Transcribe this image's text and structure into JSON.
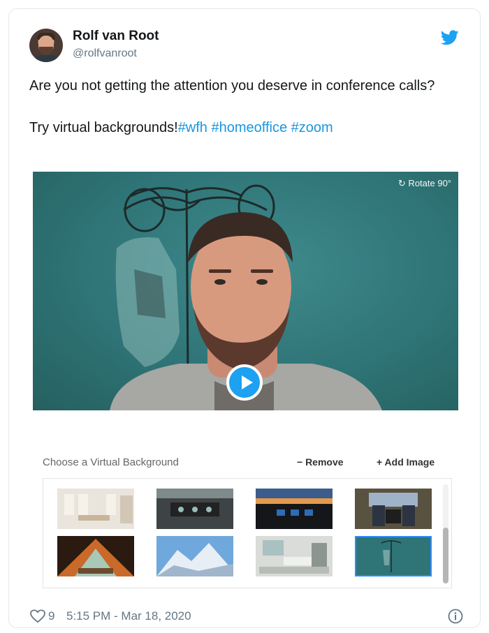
{
  "tweet": {
    "author_name": "Rolf van Root",
    "author_handle": "@rolfvanroot",
    "text_line1": "Are you not getting the attention you deserve in conference calls?",
    "text_line2_prefix": "Try virtual backgrounds!",
    "hashtags": [
      "#wfh",
      "#homeoffice",
      "#zoom"
    ],
    "like_count": "9",
    "timestamp": "5:15 PM - Mar 18, 2020"
  },
  "media": {
    "rotate_label": "↻ Rotate 90°",
    "play_icon": "play-icon"
  },
  "chooser": {
    "title": "Choose a Virtual Background",
    "remove_label": "− Remove",
    "add_label": "+ Add Image",
    "thumbnails": [
      {
        "label": "office-room"
      },
      {
        "label": "cockpit-dark"
      },
      {
        "label": "cockpit-sunset"
      },
      {
        "label": "cockpit-crew"
      },
      {
        "label": "tent-view"
      },
      {
        "label": "mountains"
      },
      {
        "label": "hospital-room"
      },
      {
        "label": "iv-drip",
        "selected": true
      }
    ]
  },
  "colors": {
    "accent": "#1da1f2",
    "hashtag": "#1b95e0",
    "media_bg": "#2f7477"
  }
}
